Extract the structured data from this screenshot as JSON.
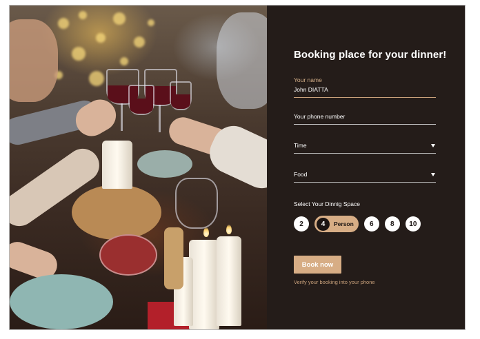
{
  "photo": {
    "alt": "Friends toasting with red wine glasses over a candle-lit dinner table"
  },
  "form": {
    "title": "Booking place for your dinner!",
    "name": {
      "label": "Your name",
      "value": "John DIATTA"
    },
    "phone": {
      "placeholder": "Your phone number"
    },
    "time": {
      "placeholder": "Time"
    },
    "food": {
      "placeholder": "Food"
    },
    "space": {
      "label": "Select Your Dinnig Space",
      "options": [
        "2",
        "4",
        "6",
        "8",
        "10"
      ],
      "selected": "4",
      "selected_suffix": "Person"
    },
    "submit_label": "Book now",
    "note": "Verify your booking into your phone"
  },
  "colors": {
    "accent": "#d7ad85",
    "panel": "#241c19",
    "label": "#d5b089"
  }
}
